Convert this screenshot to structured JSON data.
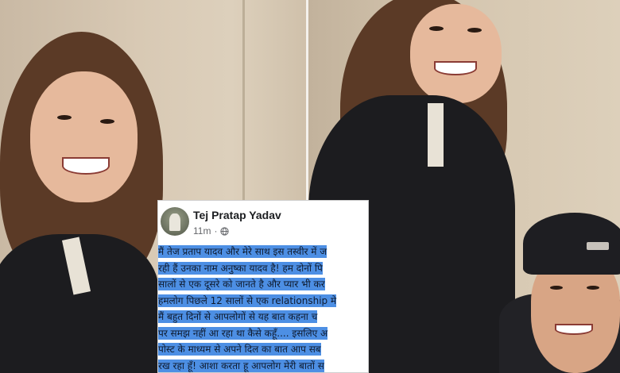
{
  "post": {
    "author": "Tej Pratap Yadav",
    "time": "11m",
    "separator": "·",
    "privacy_icon": "globe-icon",
    "lines": [
      "मैं तेज प्रताप यादव और मेरे साथ इस तस्वीर में ज",
      "रही हैं उनका नाम अनुष्का यादव है! हम दोनों पि",
      "सालों से एक दूसरे को जानते है और प्यार भी कर",
      "हमलोग पिछले 12 सालों से एक relationship मे",
      "मैं बहुत दिनों से आपलोगों से यह बात कहना च",
      "पर समझ नहीं आ रहा था कैसे कहूँ.... इसलिए अ",
      "पोस्ट के माध्यम से अपने दिल का बात आप सब",
      "रख रहा हूँ! आशा करता हू आपलोग मेरी बातों स"
    ],
    "highlight_color": "#4d8fe4"
  },
  "photo": {
    "beanie_label": "FRST"
  }
}
